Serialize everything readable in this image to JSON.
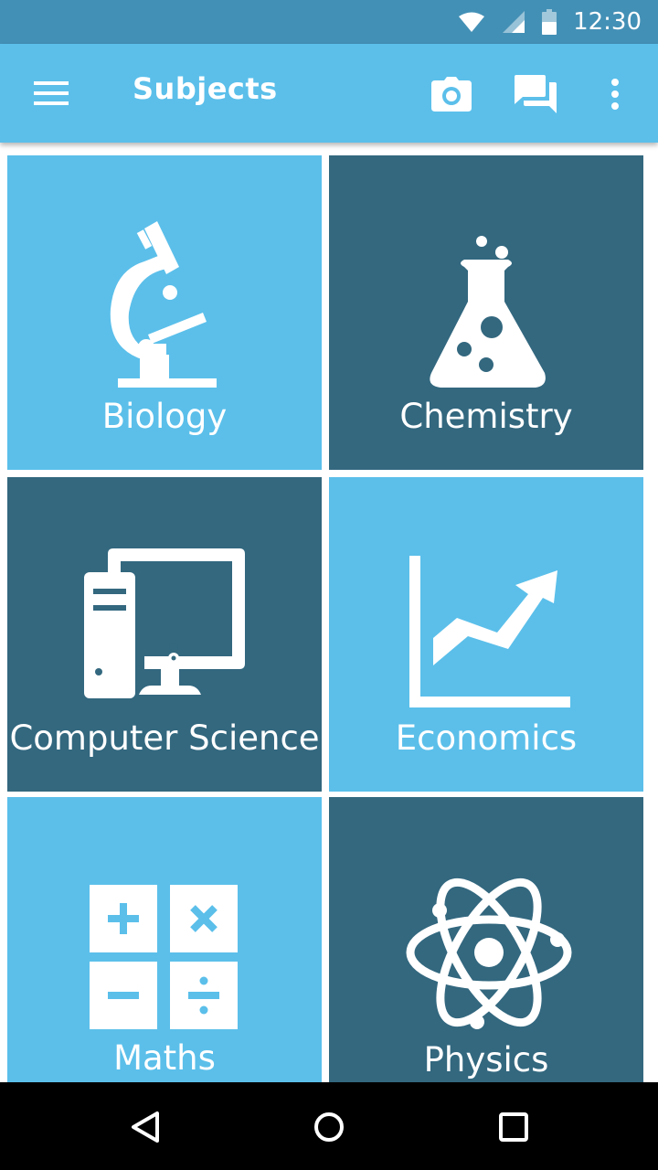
{
  "status_bar": {
    "time": "12:30",
    "icons": [
      "wifi-icon",
      "cell-signal-icon",
      "battery-icon"
    ]
  },
  "app_bar": {
    "title": "Subjects",
    "icons": [
      "menu-icon",
      "camera-icon",
      "chat-icon",
      "more-vert-icon"
    ]
  },
  "subjects": [
    {
      "label": "Biology",
      "icon": "microscope-icon"
    },
    {
      "label": "Chemistry",
      "icon": "flask-icon"
    },
    {
      "label": "Computer Science",
      "icon": "computer-icon"
    },
    {
      "label": "Economics",
      "icon": "chart-icon"
    },
    {
      "label": "Maths",
      "icon": "calculator-icon"
    },
    {
      "label": "Physics",
      "icon": "atom-icon"
    }
  ],
  "nav_bar": {
    "icons": [
      "back-icon",
      "home-icon",
      "recents-icon"
    ]
  },
  "colors": {
    "status_bar": "#4390b6",
    "app_bar": "#5bbfea",
    "tile_light": "#5bbfea",
    "tile_dark": "#33687f",
    "nav_bar": "#000000"
  }
}
